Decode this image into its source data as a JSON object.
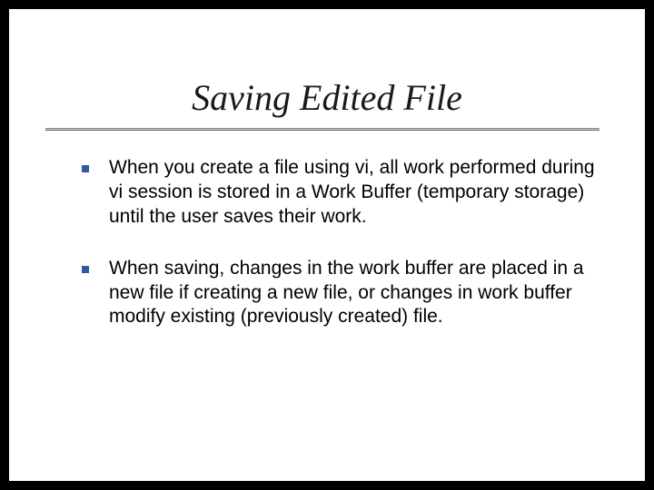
{
  "slide": {
    "title": "Saving Edited File",
    "bullets": [
      "When you create a file using vi, all work performed during vi session is stored in a Work Buffer (temporary storage) until the user saves their work.",
      "When saving, changes in the work buffer are placed in a new file if creating a new file, or changes in work buffer modify existing (previously created) file."
    ]
  }
}
